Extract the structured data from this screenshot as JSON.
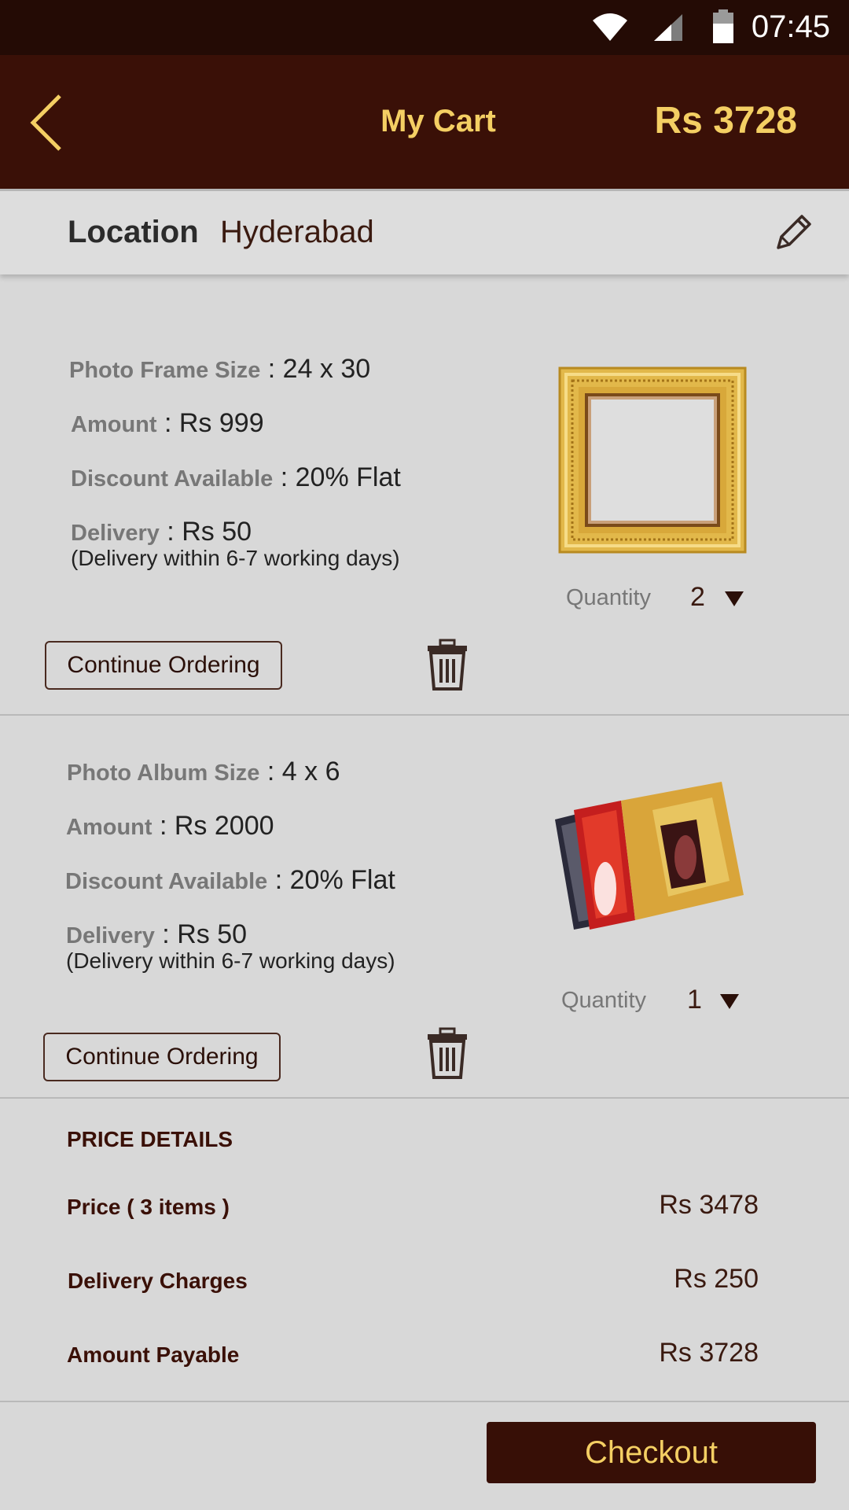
{
  "status_bar": {
    "time": "07:45"
  },
  "header": {
    "title": "My Cart",
    "total": "Rs 3728"
  },
  "location": {
    "label": "Location",
    "value": "Hyderabad"
  },
  "items": [
    {
      "size_label": "Photo Frame Size",
      "size_value": " : 24 x 30",
      "amount_label": "Amount",
      "amount_value": " : Rs 999",
      "discount_label": "Discount Available",
      "discount_value": " : 20% Flat",
      "delivery_label": "Delivery",
      "delivery_value": " : Rs 50",
      "delivery_note": "(Delivery within 6-7 working days)",
      "quantity_label": "Quantity",
      "quantity_value": "2",
      "continue_label": "Continue Ordering",
      "image": "gold-photo-frame"
    },
    {
      "size_label": "Photo Album Size",
      "size_value": " : 4 x 6",
      "amount_label": "Amount",
      "amount_value": " : Rs 2000",
      "discount_label": "Discount Available",
      "discount_value": " : 20% Flat",
      "delivery_label": "Delivery",
      "delivery_value": " : Rs 50",
      "delivery_note": "(Delivery within 6-7 working days)",
      "quantity_label": "Quantity",
      "quantity_value": "1",
      "continue_label": "Continue Ordering",
      "image": "wedding-photo-album"
    }
  ],
  "price_details": {
    "heading": "PRICE DETAILS",
    "price_label": "Price ( 3 items )",
    "price_value": "Rs 3478",
    "delivery_label": "Delivery Charges",
    "delivery_value": "Rs 250",
    "payable_label": "Amount Payable",
    "payable_value": "Rs 3728"
  },
  "checkout_label": "Checkout",
  "colors": {
    "header_bg": "#3a1007",
    "status_bg": "#240b05",
    "accent_gold": "#f4cf63",
    "page_bg": "#d8d8d8"
  }
}
